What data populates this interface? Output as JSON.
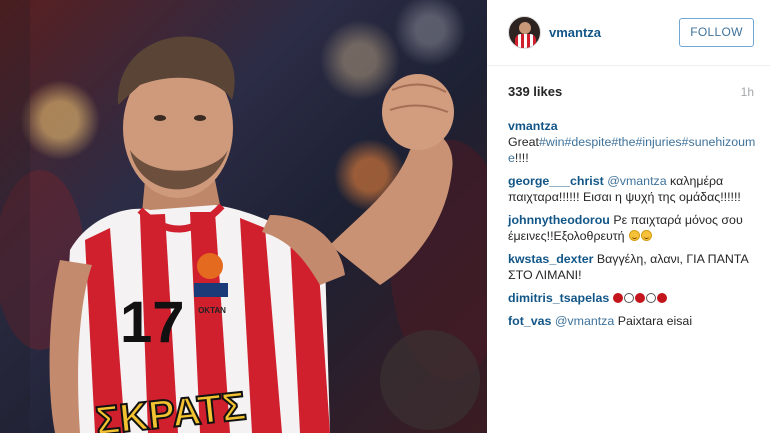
{
  "post": {
    "username": "vmantza",
    "follow_label": "FOLLOW",
    "likes": "339 likes",
    "time": "1h"
  },
  "photo": {
    "jersey_number": "17",
    "jersey_sponsor": "ΣΚΡΑΤΣ",
    "patch_text": "OKTAN"
  },
  "comments": [
    {
      "user": "vmantza",
      "parts": [
        {
          "t": "text",
          "v": " Great"
        },
        {
          "t": "tag",
          "v": "#win"
        },
        {
          "t": "tag",
          "v": "#despite"
        },
        {
          "t": "tag",
          "v": "#the"
        },
        {
          "t": "tag",
          "v": "#injuries"
        },
        {
          "t": "tag",
          "v": "#sunehizoume"
        },
        {
          "t": "text",
          "v": "!!!!"
        }
      ]
    },
    {
      "user": "george___christ",
      "parts": [
        {
          "t": "text",
          "v": " "
        },
        {
          "t": "mention",
          "v": "@vmantza"
        },
        {
          "t": "text",
          "v": " καλημέρα παιχταρα!!!!!! Εισαι η ψυχή της ομάδας!!!!!!"
        }
      ]
    },
    {
      "user": "johnnytheodorou",
      "parts": [
        {
          "t": "text",
          "v": " Ρε παιχταρά μόνος σου έμεινες!!Εξολοθρευτή "
        },
        {
          "t": "emoji",
          "v": "grinning-face"
        },
        {
          "t": "emoji",
          "v": "grinning-face"
        }
      ]
    },
    {
      "user": "kwstas_dexter",
      "parts": [
        {
          "t": "text",
          "v": " Βαγγέλη, αλανι, ΓΙΑ ΠΑΝΤΑ ΣΤΟ ΛΙΜΑΝΙ!"
        }
      ]
    },
    {
      "user": "dimitris_tsapelas",
      "parts": [
        {
          "t": "text",
          "v": " "
        },
        {
          "t": "dot",
          "v": "filled"
        },
        {
          "t": "dot",
          "v": "hollow"
        },
        {
          "t": "dot",
          "v": "filled"
        },
        {
          "t": "dot",
          "v": "hollow"
        },
        {
          "t": "dot",
          "v": "filled"
        }
      ]
    },
    {
      "user": "fot_vas",
      "parts": [
        {
          "t": "text",
          "v": " "
        },
        {
          "t": "mention",
          "v": "@vmantza"
        },
        {
          "t": "text",
          "v": " Paixtara eisai"
        }
      ]
    }
  ],
  "colors": {
    "username": "#125688",
    "hashtag": "#3f729b",
    "follow_border": "#70a7d3",
    "jersey_red": "#d0202e"
  }
}
